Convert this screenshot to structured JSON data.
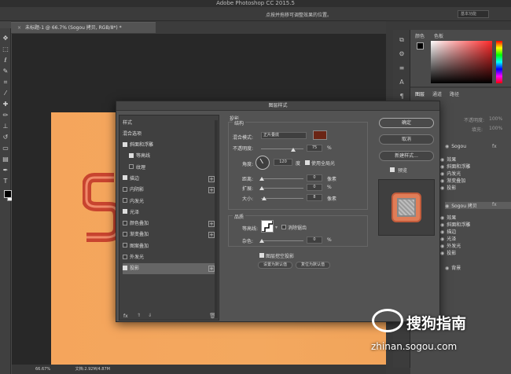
{
  "app": {
    "title": "Adobe Photoshop CC 2015.5",
    "hint": "点按并拖移可调整效果的位置。",
    "workspace": "基本功能"
  },
  "document": {
    "tab_label": "未标题-1 @ 66.7% (Sogou 拷贝, RGB/8*) *",
    "status_zoom": "66.67%",
    "status_doc": "文档:2.92M/4.87M"
  },
  "panels": {
    "color_tab": "颜色",
    "swatches_tab": "色板",
    "layers_tab": "图层",
    "channels_tab": "通道",
    "paths_tab": "路径",
    "opacity_label": "不透明度:",
    "opacity_value": "100%",
    "fill_label": "填充:",
    "fill_value": "100%"
  },
  "layers": [
    {
      "name": "Sogou",
      "fx": "fx"
    },
    {
      "name": "效果"
    },
    {
      "name": "斜面和浮雕"
    },
    {
      "name": "内发光"
    },
    {
      "name": "渐变叠加"
    },
    {
      "name": "投影"
    },
    {
      "name": "Sogou 拷贝",
      "fx": "fx"
    },
    {
      "name": "效果"
    },
    {
      "name": "斜面和浮雕"
    },
    {
      "name": "描边"
    },
    {
      "name": "光泽"
    },
    {
      "name": "外发光"
    },
    {
      "name": "投影"
    },
    {
      "name": "背景"
    }
  ],
  "dialog": {
    "title": "图层样式",
    "styles_header": "样式",
    "blend_options": "混合选项",
    "style_items": [
      {
        "label": "斜面和浮雕",
        "checked": true,
        "plus": false
      },
      {
        "label": "等高线",
        "checked": true,
        "plus": false
      },
      {
        "label": "纹理",
        "checked": false,
        "plus": false
      },
      {
        "label": "描边",
        "checked": true,
        "plus": true
      },
      {
        "label": "内阴影",
        "checked": false,
        "plus": true
      },
      {
        "label": "内发光",
        "checked": false,
        "plus": false
      },
      {
        "label": "光泽",
        "checked": true,
        "plus": false
      },
      {
        "label": "颜色叠加",
        "checked": false,
        "plus": true
      },
      {
        "label": "渐变叠加",
        "checked": false,
        "plus": true
      },
      {
        "label": "图案叠加",
        "checked": false,
        "plus": false
      },
      {
        "label": "外发光",
        "checked": false,
        "plus": false
      },
      {
        "label": "投影",
        "checked": true,
        "plus": true
      }
    ],
    "fx_footer": "fx",
    "section_title": "投影",
    "structure_title": "结构",
    "blend_mode_label": "混合模式:",
    "blend_mode_value": "正片叠底",
    "shadow_color": "#6b2515",
    "opacity_label": "不透明度:",
    "opacity_value": "75",
    "opacity_unit": "%",
    "opacity_level": 0.75,
    "angle_label": "角度:",
    "angle_value": "120",
    "angle_unit": "度",
    "global_light_label": "使用全局光",
    "distance_label": "距离:",
    "distance_value": "0",
    "distance_unit": "像素",
    "spread_label": "扩展:",
    "spread_value": "0",
    "spread_unit": "%",
    "size_label": "大小:",
    "size_value": "8",
    "size_unit": "像素",
    "quality_title": "品质",
    "contour_label": "等高线:",
    "antialias_label": "消除锯齿",
    "noise_label": "杂色:",
    "noise_value": "0",
    "noise_unit": "%",
    "knockout_label": "图层挖空投影",
    "set_default": "设置为默认值",
    "reset_default": "复位为默认值",
    "ok": "确定",
    "cancel": "取消",
    "new_style": "新建样式...",
    "preview": "预览"
  },
  "watermark": {
    "brand": "搜狗指南",
    "url": "zhinan.sogou.com"
  }
}
